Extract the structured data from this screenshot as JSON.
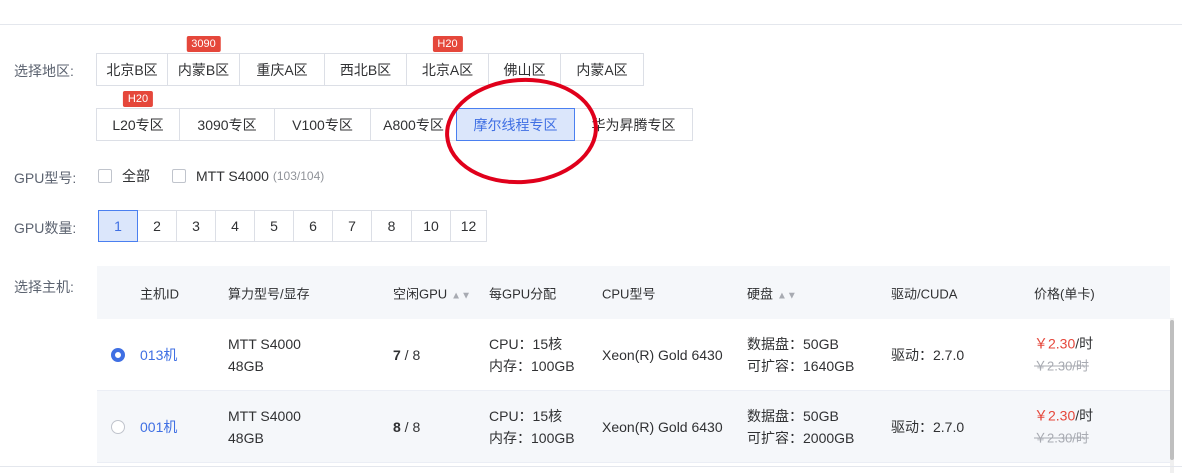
{
  "labels": {
    "region": "选择地区:",
    "gpu_type": "GPU型号:",
    "gpu_count": "GPU数量:",
    "host": "选择主机:"
  },
  "regions_row1": [
    {
      "label": "北京B区",
      "badge": ""
    },
    {
      "label": "内蒙B区",
      "badge": "3090"
    },
    {
      "label": "重庆A区",
      "badge": ""
    },
    {
      "label": "西北B区",
      "badge": ""
    },
    {
      "label": "北京A区",
      "badge": "H20"
    },
    {
      "label": "佛山区",
      "badge": ""
    },
    {
      "label": "内蒙A区",
      "badge": ""
    }
  ],
  "regions_row2": [
    {
      "label": "L20专区",
      "badge": "H20"
    },
    {
      "label": "3090专区",
      "badge": ""
    },
    {
      "label": "V100专区",
      "badge": ""
    },
    {
      "label": "A800专区",
      "badge": ""
    },
    {
      "label": "摩尔线程专区",
      "badge": "",
      "selected": true
    },
    {
      "label": "华为昇腾专区",
      "badge": ""
    }
  ],
  "gpu_types": [
    {
      "label": "全部",
      "count": ""
    },
    {
      "label": "MTT S4000",
      "count": "(103/104)"
    }
  ],
  "gpu_counts": [
    "1",
    "2",
    "3",
    "4",
    "5",
    "6",
    "7",
    "8",
    "10",
    "12"
  ],
  "gpu_count_selected": "1",
  "table": {
    "headers": {
      "host_id": "主机ID",
      "model": "算力型号/显存",
      "idle": "空闲GPU",
      "per_gpu": "每GPU分配",
      "cpu": "CPU型号",
      "disk": "硬盘",
      "driver": "驱动/CUDA",
      "price": "价格(单卡)"
    },
    "rows": [
      {
        "selected": true,
        "host_id": "013机",
        "model": "MTT S4000",
        "memory": "48GB",
        "idle": "7",
        "idle_total": " / 8",
        "cpu_alloc": "CPU：15核",
        "mem_alloc": "内存：100GB",
        "cpu_model": "Xeon(R) Gold 6430",
        "data_disk": "数据盘：50GB",
        "expandable": "可扩容：1640GB",
        "driver": "驱动：2.7.0",
        "price": "￥2.30",
        "price_unit": "/时",
        "old_price": "￥2.30/时"
      },
      {
        "selected": false,
        "host_id": "001机",
        "model": "MTT S4000",
        "memory": "48GB",
        "idle": "8",
        "idle_total": " / 8",
        "cpu_alloc": "CPU：15核",
        "mem_alloc": "内存：100GB",
        "cpu_model": "Xeon(R) Gold 6430",
        "data_disk": "数据盘：50GB",
        "expandable": "可扩容：2000GB",
        "driver": "驱动：2.7.0",
        "price": "￥2.30",
        "price_unit": "/时",
        "old_price": "￥2.30/时"
      }
    ]
  },
  "colors": {
    "accent": "#3f6fe3",
    "badge": "#e5473b",
    "annotation_circle": "#e0001b"
  }
}
